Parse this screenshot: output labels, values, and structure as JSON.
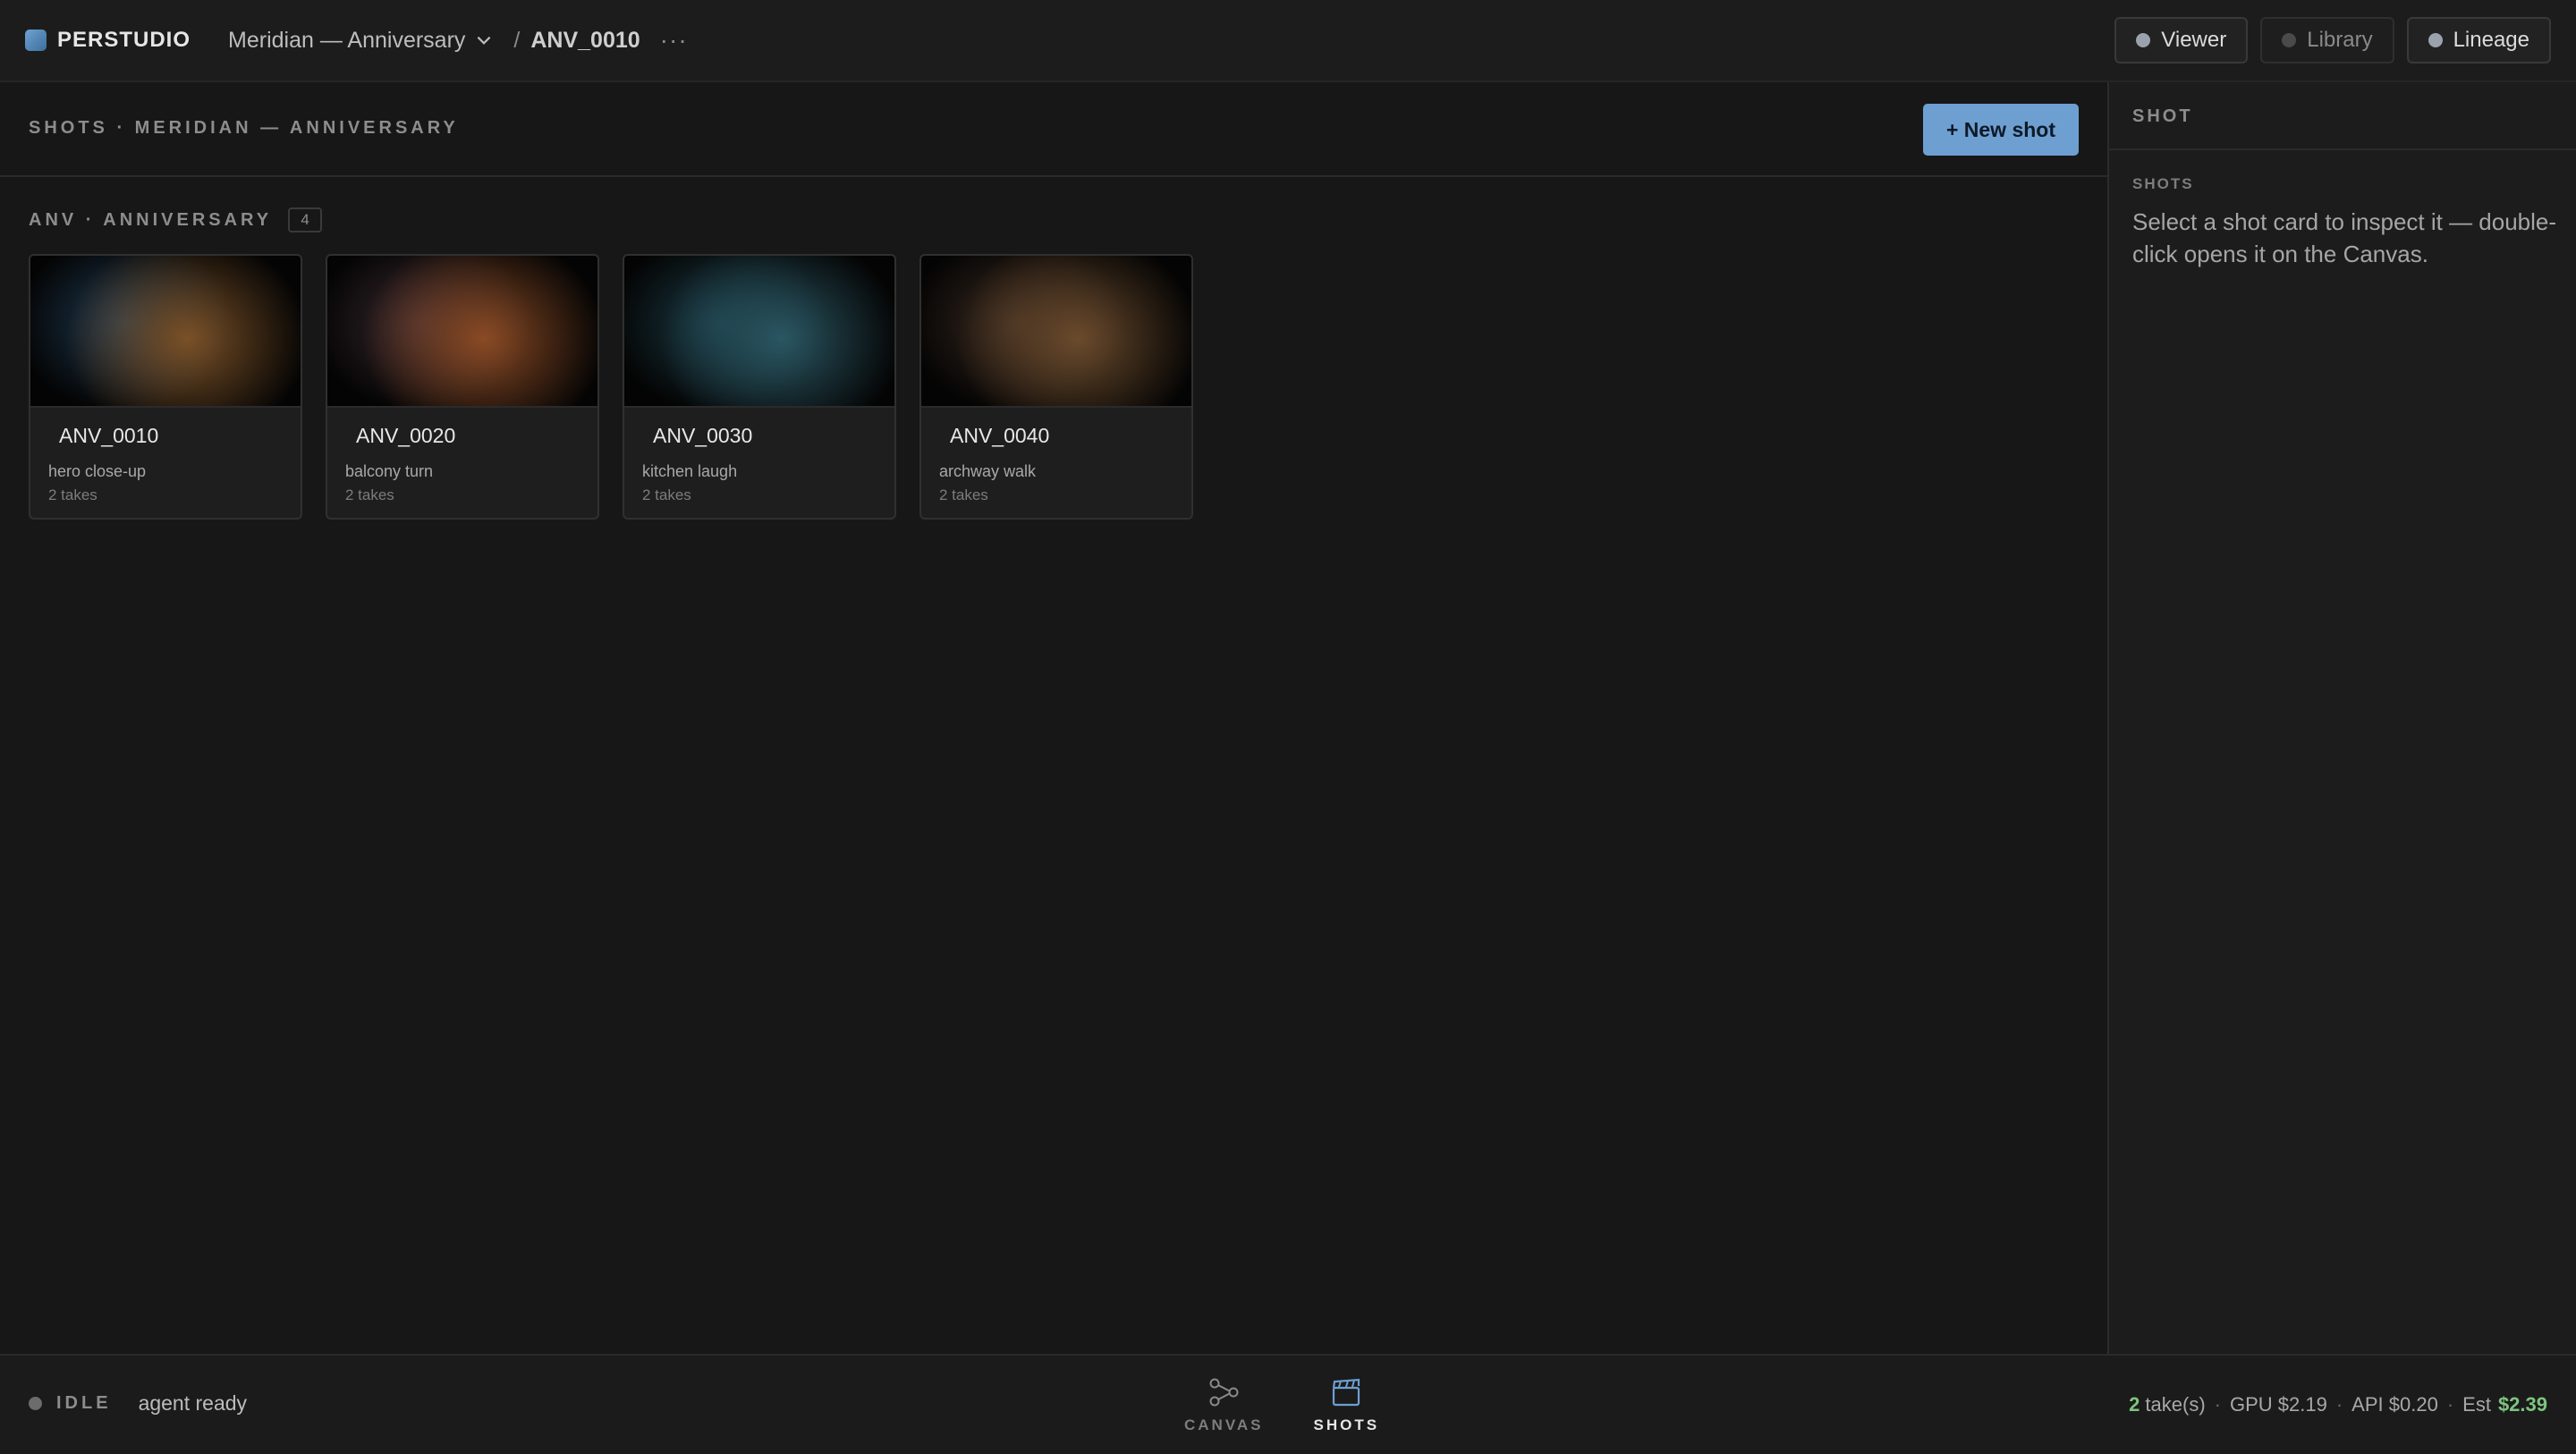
{
  "app": {
    "name": "PERSTUDIO"
  },
  "breadcrumb": {
    "project": "Meridian — Anniversary",
    "separator": "/",
    "shot": "ANV_0010",
    "more": "···"
  },
  "panels": [
    {
      "label": "Viewer",
      "on": true
    },
    {
      "label": "Library",
      "on": false
    },
    {
      "label": "Lineage",
      "on": true
    }
  ],
  "main": {
    "title": "SHOTS · MERIDIAN — ANNIVERSARY",
    "new_shot_label": "+ New shot",
    "group": {
      "label": "ANV · ANNIVERSARY",
      "count": "4"
    },
    "shots": [
      {
        "id": "ANV_0010",
        "desc": "hero close-up",
        "takes": "2 takes",
        "tint": "#7a5026",
        "tint2": "#1e3a52"
      },
      {
        "id": "ANV_0020",
        "desc": "balcony turn",
        "takes": "2 takes",
        "tint": "#8a4a24",
        "tint2": "#3a2a30"
      },
      {
        "id": "ANV_0030",
        "desc": "kitchen laugh",
        "takes": "2 takes",
        "tint": "#2a5662",
        "tint2": "#1a3a44"
      },
      {
        "id": "ANV_0040",
        "desc": "archway walk",
        "takes": "2 takes",
        "tint": "#6a4a2c",
        "tint2": "#3a2a20"
      }
    ]
  },
  "inspector": {
    "title": "SHOT",
    "section": "SHOTS",
    "hint": "Select a shot card to inspect it — double-click opens it on the Canvas."
  },
  "status": {
    "state": "IDLE",
    "message": "agent ready"
  },
  "views": [
    {
      "label": "CANVAS",
      "icon": "graph-icon",
      "active": false
    },
    {
      "label": "SHOTS",
      "icon": "clapperboard-icon",
      "active": true
    }
  ],
  "costs": {
    "takes_count": "2",
    "takes_label": "take(s)",
    "gpu": "GPU $2.19",
    "api": "API $0.20",
    "est_label": "Est",
    "est_value": "$2.39"
  },
  "colors": {
    "accent": "#6e9fd1",
    "cost_green": "#7fc47f",
    "background": "#161616"
  }
}
